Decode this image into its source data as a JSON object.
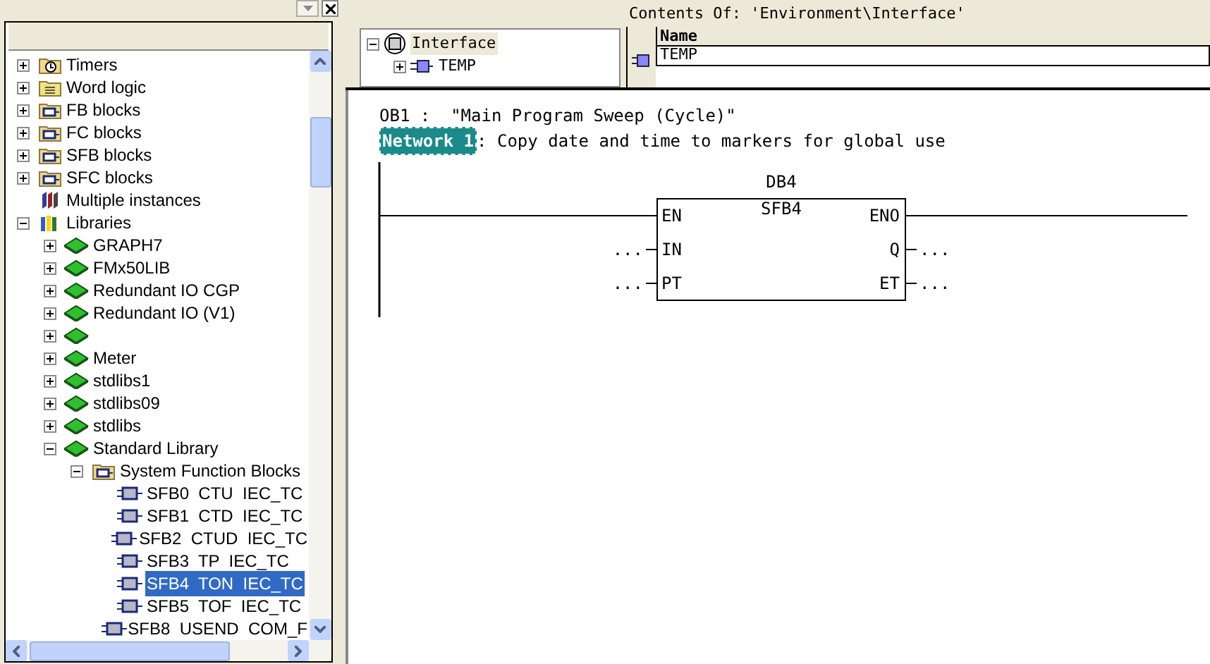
{
  "library_tree": [
    {
      "label": "Timers",
      "kind": "clock",
      "expanded": false,
      "selected": false
    },
    {
      "label": "Word logic",
      "kind": "word",
      "expanded": false,
      "selected": false
    },
    {
      "label": "FB blocks",
      "kind": "blockfolder",
      "expanded": false,
      "selected": false
    },
    {
      "label": "FC blocks",
      "kind": "blockfolder",
      "expanded": false,
      "selected": false
    },
    {
      "label": "SFB blocks",
      "kind": "blockfolder",
      "expanded": false,
      "selected": false
    },
    {
      "label": "SFC blocks",
      "kind": "blockfolder",
      "expanded": false,
      "selected": false
    },
    {
      "label": "Multiple instances",
      "kind": "instances",
      "selected": false
    },
    {
      "label": "Libraries",
      "kind": "libraries",
      "expanded": true,
      "selected": false,
      "children": [
        {
          "label": "GRAPH7",
          "kind": "book",
          "expanded": false,
          "selected": false
        },
        {
          "label": "FMx50LIB",
          "kind": "book",
          "expanded": false,
          "selected": false
        },
        {
          "label": "Redundant IO CGP",
          "kind": "book",
          "expanded": false,
          "selected": false
        },
        {
          "label": "Redundant IO (V1)",
          "kind": "book",
          "expanded": false,
          "selected": false
        },
        {
          "kind": "book",
          "expanded": false
        },
        {
          "label": "Meter",
          "kind": "book",
          "expanded": false,
          "selected": false
        },
        {
          "label": "stdlibs1",
          "kind": "book",
          "expanded": false,
          "selected": false
        },
        {
          "label": "stdlibs09",
          "kind": "book",
          "expanded": false,
          "selected": false
        },
        {
          "label": "stdlibs",
          "kind": "book",
          "expanded": false,
          "selected": false
        },
        {
          "label": "Standard Library",
          "kind": "book",
          "expanded": true,
          "selected": false,
          "children": [
            {
              "label": "System Function Blocks",
              "kind": "blockfolder",
              "expanded": true,
              "selected": false,
              "children": [
                {
                  "label": "SFB0  CTU  IEC_TC",
                  "kind": "block",
                  "selected": false
                },
                {
                  "label": "SFB1  CTD  IEC_TC",
                  "kind": "block",
                  "selected": false
                },
                {
                  "label": "SFB2  CTUD  IEC_TC",
                  "kind": "block",
                  "selected": false
                },
                {
                  "label": "SFB3  TP  IEC_TC",
                  "kind": "block",
                  "selected": false
                },
                {
                  "label": "SFB4  TON  IEC_TC",
                  "kind": "block",
                  "selected": true
                },
                {
                  "label": "SFB5  TOF  IEC_TC",
                  "kind": "block",
                  "selected": false
                },
                {
                  "label": "SFB8  USEND  COM_F",
                  "kind": "block",
                  "selected": false
                }
              ]
            }
          ]
        }
      ]
    }
  ],
  "interface_tree": [
    {
      "label": "Interface",
      "expanded": true,
      "children": [
        {
          "label": "TEMP",
          "expanded": false
        }
      ]
    }
  ],
  "contents": {
    "title": "Contents Of: 'Environment\\Interface'",
    "columns": [
      "Name"
    ],
    "rows": [
      "TEMP"
    ]
  },
  "editor": {
    "block_title": "OB1 :  \"Main Program Sweep (Cycle)\"",
    "network": {
      "label": "Network 1",
      "title": ": Copy date and time to markers for global use"
    },
    "box": {
      "instance": "DB4",
      "type": "SFB4",
      "inputs": [
        {
          "pin": "EN"
        },
        {
          "pin": "IN",
          "operand": "..."
        },
        {
          "pin": "PT",
          "operand": "..."
        }
      ],
      "outputs": [
        {
          "pin": "ENO"
        },
        {
          "pin": "Q",
          "operand": "..."
        },
        {
          "pin": "ET",
          "operand": "..."
        }
      ]
    }
  }
}
